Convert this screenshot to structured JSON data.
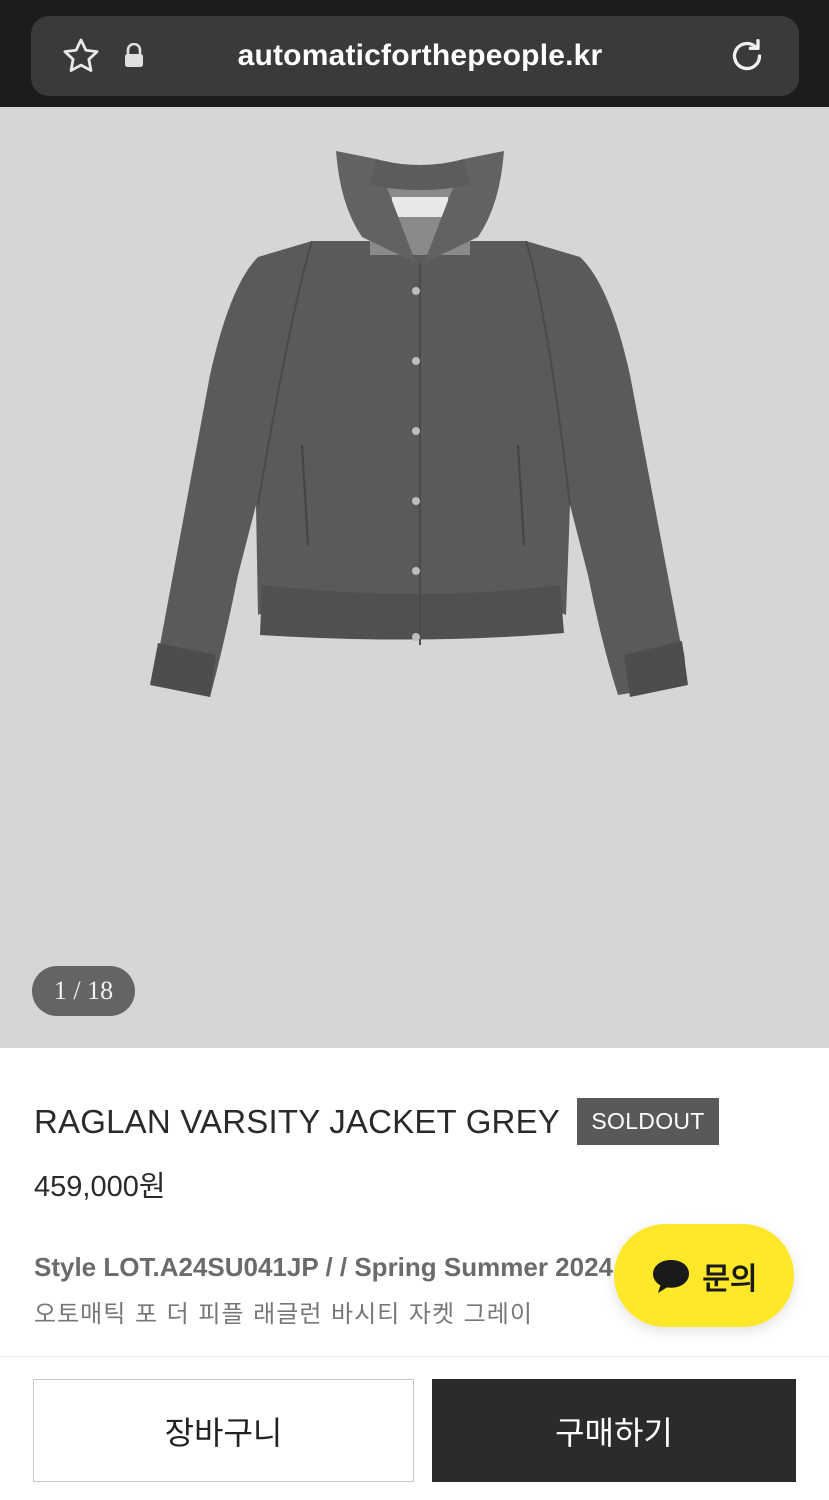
{
  "browser": {
    "url": "automaticforthepeople.kr",
    "icons": [
      "star-icon",
      "lock-icon",
      "reload-icon"
    ]
  },
  "gallery": {
    "counter": "1 / 18",
    "background": "#d6d6d6"
  },
  "product": {
    "title": "RAGLAN VARSITY JACKET GREY",
    "badge": "SOLDOUT",
    "price": "459,000원",
    "style_line": "Style LOT.A24SU041JP / / Spring Summer 2024",
    "korean_name": "오토매틱 포 더 피플 래글런 바시티 자켓 그레이"
  },
  "inquiry": {
    "label": "문의",
    "icon": "chat-bubble-icon",
    "color": "#ffe82a"
  },
  "actions": {
    "cart_label": "장바구니",
    "buy_label": "구매하기"
  }
}
